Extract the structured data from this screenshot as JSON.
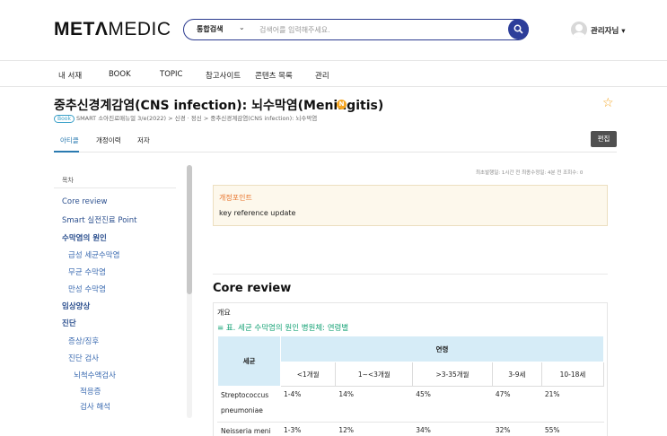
{
  "header": {
    "logo_bold": "METΛ",
    "logo_light": "MEDIC",
    "search_scope": "통합검색",
    "search_placeholder": "검색어를 입력해주세요.",
    "user_name": "관리자님 ▾"
  },
  "nav": [
    "내 서재",
    "BOOK",
    "TOPIC",
    "참고사이트",
    "콘텐츠 목록",
    "관리"
  ],
  "article": {
    "title": "중추신경계감염(CNS infection): 뇌수막염(Meningitis)",
    "new_badge": "N",
    "book_badge": "Book",
    "breadcrumb": "SMART 소아진료매뉴얼 3/e(2022) > 신경 · 정신 > 중추신경계감염(CNS infection): 뇌수막염"
  },
  "tabs": [
    "아티클",
    "개정이력",
    "저자"
  ],
  "edit_label": "편집",
  "toc": {
    "title": "목차",
    "items": [
      "Core review",
      "Smart 실전진료 Point",
      "수막염의 원인",
      "급성 세균수막염",
      "무균 수막염",
      "만성 수막염",
      "임상양상",
      "진단",
      "증상/징후",
      "진단 검사",
      "뇌척수액검사",
      "적응증",
      "검사 해석"
    ]
  },
  "content": {
    "meta": "최초발행일: 1시간 전   최종수정일: 4분 전   조회수: 0",
    "revision_heading": "개정포인트",
    "revision_text": "key reference update",
    "section_title": "Core review",
    "overview_label": "개요",
    "table_caption": "≡ 표. 세균 수막염의 원인 병원체: 연령별",
    "table": {
      "col_pathogen": "세균",
      "col_age": "연령",
      "age_groups": [
        "<1개월",
        "1~<3개월",
        ">3-35개월",
        "3-9세",
        "10-18세"
      ],
      "rows": [
        {
          "pathogen": "Streptococcus pneumoniae",
          "values": [
            "1-4%",
            "14%",
            "45%",
            "47%",
            "21%"
          ]
        },
        {
          "pathogen": "Neisseria meni",
          "values": [
            "1-3%",
            "12%",
            "34%",
            "32%",
            "55%"
          ]
        }
      ]
    }
  }
}
